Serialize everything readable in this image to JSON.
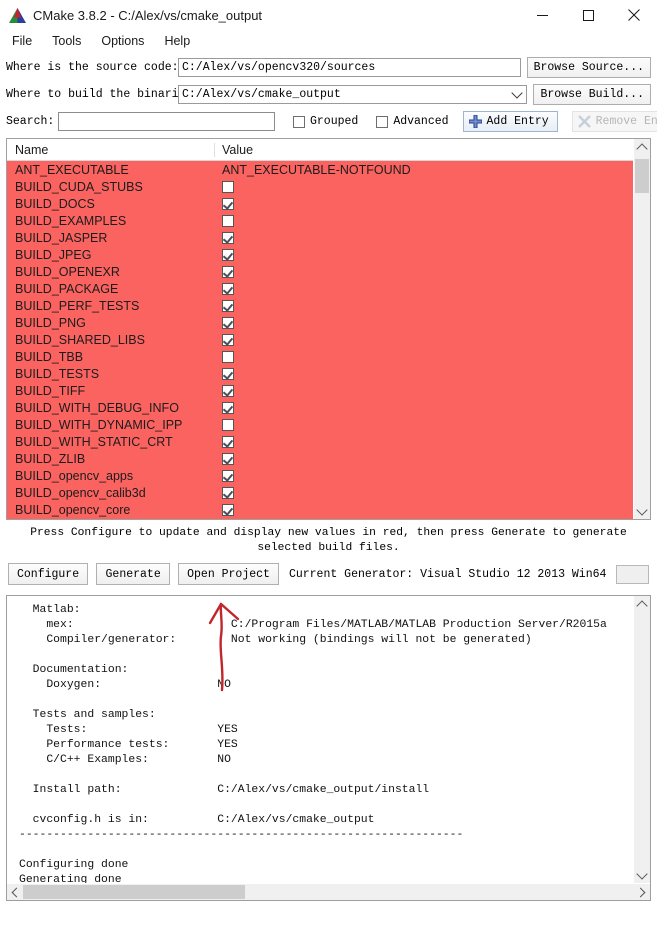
{
  "window": {
    "title": "CMake 3.8.2 - C:/Alex/vs/cmake_output",
    "logo_icon": "cmake-triangle-logo",
    "minimize_icon": "minimize-icon",
    "maximize_icon": "maximize-icon",
    "close_icon": "close-icon"
  },
  "menubar": {
    "items": [
      {
        "label": "File"
      },
      {
        "label": "Tools"
      },
      {
        "label": "Options"
      },
      {
        "label": "Help"
      }
    ]
  },
  "source_row": {
    "label": "Where is the source code:",
    "value": "C:/Alex/vs/opencv320/sources",
    "button": "Browse Source..."
  },
  "build_row": {
    "label": "Where to build the binaries:",
    "value": "C:/Alex/vs/cmake_output",
    "button": "Browse Build...",
    "dropdown_icon": "chevron-down-icon"
  },
  "search_row": {
    "label": "Search:",
    "value": "",
    "placeholder": "",
    "grouped_label": "Grouped",
    "grouped_checked": false,
    "advanced_label": "Advanced",
    "advanced_checked": false,
    "add_entry_label": "Add Entry",
    "add_entry_icon": "plus-icon",
    "remove_entry_label": "Remove Entry",
    "remove_entry_icon": "remove-x-icon",
    "remove_entry_disabled": true
  },
  "cache_table": {
    "columns": [
      "Name",
      "Value"
    ],
    "row_highlight_color": "#fa6360",
    "rows": [
      {
        "name": "ANT_EXECUTABLE",
        "type": "text",
        "value": "ANT_EXECUTABLE-NOTFOUND"
      },
      {
        "name": "BUILD_CUDA_STUBS",
        "type": "bool",
        "checked": false
      },
      {
        "name": "BUILD_DOCS",
        "type": "bool",
        "checked": true
      },
      {
        "name": "BUILD_EXAMPLES",
        "type": "bool",
        "checked": false
      },
      {
        "name": "BUILD_JASPER",
        "type": "bool",
        "checked": true
      },
      {
        "name": "BUILD_JPEG",
        "type": "bool",
        "checked": true
      },
      {
        "name": "BUILD_OPENEXR",
        "type": "bool",
        "checked": true
      },
      {
        "name": "BUILD_PACKAGE",
        "type": "bool",
        "checked": true
      },
      {
        "name": "BUILD_PERF_TESTS",
        "type": "bool",
        "checked": true
      },
      {
        "name": "BUILD_PNG",
        "type": "bool",
        "checked": true
      },
      {
        "name": "BUILD_SHARED_LIBS",
        "type": "bool",
        "checked": true
      },
      {
        "name": "BUILD_TBB",
        "type": "bool",
        "checked": false
      },
      {
        "name": "BUILD_TESTS",
        "type": "bool",
        "checked": true
      },
      {
        "name": "BUILD_TIFF",
        "type": "bool",
        "checked": true
      },
      {
        "name": "BUILD_WITH_DEBUG_INFO",
        "type": "bool",
        "checked": true
      },
      {
        "name": "BUILD_WITH_DYNAMIC_IPP",
        "type": "bool",
        "checked": false
      },
      {
        "name": "BUILD_WITH_STATIC_CRT",
        "type": "bool",
        "checked": true
      },
      {
        "name": "BUILD_ZLIB",
        "type": "bool",
        "checked": true
      },
      {
        "name": "BUILD_opencv_apps",
        "type": "bool",
        "checked": true
      },
      {
        "name": "BUILD_opencv_calib3d",
        "type": "bool",
        "checked": true
      },
      {
        "name": "BUILD_opencv_core",
        "type": "bool",
        "checked": true
      }
    ],
    "scroll_up_icon": "chevron-up-icon",
    "scroll_down_icon": "chevron-down-icon"
  },
  "hint": "Press Configure to update and display new values in red, then press Generate to generate selected build files.",
  "actions": {
    "configure": "Configure",
    "generate": "Generate",
    "open_project": "Open Project",
    "generator_label": "Current Generator: Visual Studio 12 2013 Win64",
    "progress_value": ""
  },
  "output": {
    "text": "  Matlab:\n    mex:                       C:/Program Files/MATLAB/MATLAB Production Server/R2015a\n    Compiler/generator:        Not working (bindings will not be generated)\n\n  Documentation:\n    Doxygen:                 NO\n\n  Tests and samples:\n    Tests:                   YES\n    Performance tests:       YES\n    C/C++ Examples:          NO\n\n  Install path:              C:/Alex/vs/cmake_output/install\n\n  cvconfig.h is in:          C:/Alex/vs/cmake_output\n-----------------------------------------------------------------\n\nConfiguring done\nGenerating done",
    "scroll_left_icon": "chevron-left-icon",
    "scroll_right_icon": "chevron-right-icon",
    "scroll_up_icon": "chevron-up-icon",
    "scroll_down_icon": "chevron-down-icon"
  },
  "annotation": {
    "arrow_color": "#c0272d",
    "description": "red-hand-drawn-arrow-pointing-to-open-project"
  }
}
